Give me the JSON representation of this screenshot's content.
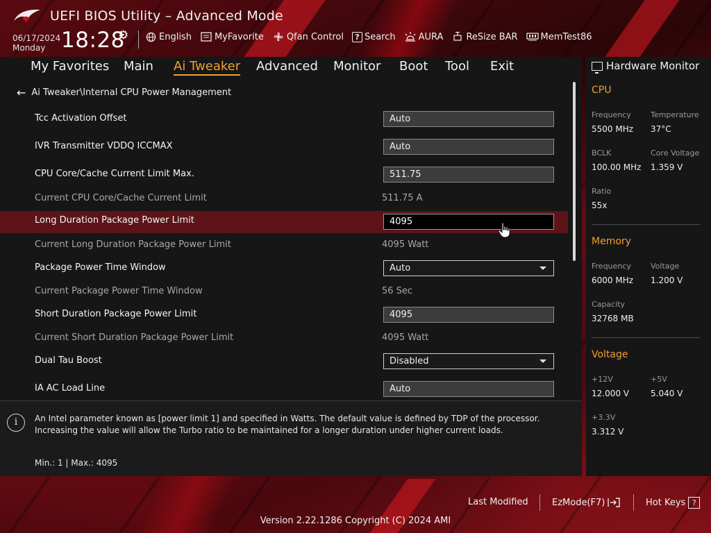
{
  "header": {
    "title": "UEFI BIOS Utility – Advanced Mode",
    "date": "06/17/2024",
    "day": "Monday",
    "time": "18:28",
    "toolbar": [
      {
        "label": "English",
        "icon": "globe-icon"
      },
      {
        "label": "MyFavorite",
        "icon": "favorite-icon"
      },
      {
        "label": "Qfan Control",
        "icon": "fan-icon"
      },
      {
        "label": "Search",
        "icon": "search-help-icon"
      },
      {
        "label": "AURA",
        "icon": "aura-light-icon"
      },
      {
        "label": "ReSize BAR",
        "icon": "resize-bar-icon"
      },
      {
        "label": "MemTest86",
        "icon": "memtest-icon"
      }
    ]
  },
  "tabs": [
    "My Favorites",
    "Main",
    "Ai Tweaker",
    "Advanced",
    "Monitor",
    "Boot",
    "Tool",
    "Exit"
  ],
  "active_tab": "Ai Tweaker",
  "breadcrumb": "Ai Tweaker\\Internal CPU Power Management",
  "settings": [
    {
      "label": "Tcc Activation Offset",
      "value": "Auto",
      "kind": "field"
    },
    {
      "label": "IVR Transmitter VDDQ ICCMAX",
      "value": "Auto",
      "kind": "field"
    },
    {
      "label": "CPU Core/Cache Current Limit Max.",
      "value": "511.75",
      "kind": "field"
    },
    {
      "label": "Current CPU Core/Cache Current Limit",
      "value": "511.75 A",
      "kind": "info"
    },
    {
      "label": "Long Duration Package Power Limit",
      "value": "4095",
      "kind": "editing"
    },
    {
      "label": "Current Long Duration Package Power Limit",
      "value": "4095 Watt",
      "kind": "info"
    },
    {
      "label": "Package Power Time Window",
      "value": "Auto",
      "kind": "dropdown"
    },
    {
      "label": "Current Package Power Time Window",
      "value": "56 Sec",
      "kind": "info"
    },
    {
      "label": "Short Duration Package Power Limit",
      "value": "4095",
      "kind": "field"
    },
    {
      "label": "Current Short Duration Package Power Limit",
      "value": "4095 Watt",
      "kind": "info"
    },
    {
      "label": "Dual Tau Boost",
      "value": "Disabled",
      "kind": "dropdown"
    },
    {
      "label": "IA AC Load Line",
      "value": "Auto",
      "kind": "field"
    }
  ],
  "help": {
    "text": "An Intel parameter known as [power limit 1] and specified in Watts. The default value is defined by TDP of the processor. Increasing the value will allow the Turbo ratio to be maintained for a longer duration under higher current loads.",
    "minmax": "Min.: 1   |   Max.: 4095"
  },
  "hardware_monitor": {
    "title": "Hardware Monitor",
    "cpu": {
      "heading": "CPU",
      "frequency_label": "Frequency",
      "frequency": "5500 MHz",
      "temperature_label": "Temperature",
      "temperature": "37°C",
      "bclk_label": "BCLK",
      "bclk": "100.00 MHz",
      "core_voltage_label": "Core Voltage",
      "core_voltage": "1.359 V",
      "ratio_label": "Ratio",
      "ratio": "55x"
    },
    "memory": {
      "heading": "Memory",
      "frequency_label": "Frequency",
      "frequency": "6000 MHz",
      "voltage_label": "Voltage",
      "voltage": "1.200 V",
      "capacity_label": "Capacity",
      "capacity": "32768 MB"
    },
    "voltage": {
      "heading": "Voltage",
      "v12_label": "+12V",
      "v12": "12.000 V",
      "v5_label": "+5V",
      "v5": "5.040 V",
      "v33_label": "+3.3V",
      "v33": "3.312 V"
    }
  },
  "footer": {
    "last_modified": "Last Modified",
    "ezmode": "EzMode(F7)",
    "hotkeys": "Hot Keys",
    "version": "Version 2.22.1286 Copyright (C) 2024 AMI"
  },
  "colors": {
    "accent": "#f0a030",
    "highlight_row": "#5c1418",
    "panel": "#161616"
  }
}
